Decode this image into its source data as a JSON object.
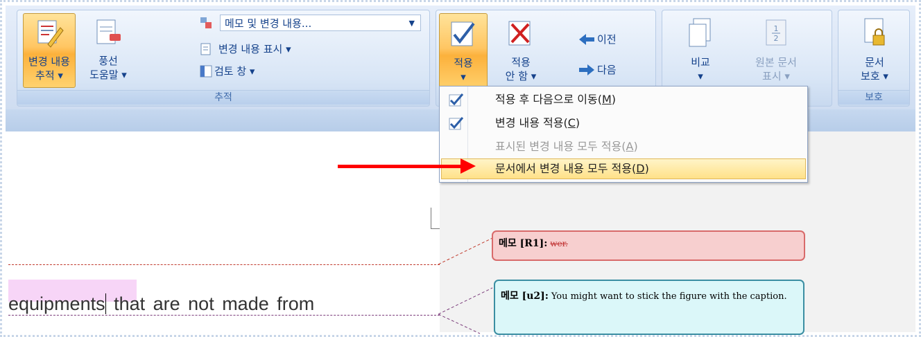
{
  "ribbon": {
    "track_group": {
      "track_changes": {
        "line1": "변경 내용",
        "line2": "추적 ▾"
      },
      "balloons": {
        "line1": "풍선",
        "line2": "도움말 ▾"
      },
      "markup_combo": "메모 및 변경 내용...",
      "show_markup": "변경 내용 표시 ▾",
      "review_pane": "검토 창 ▾",
      "label": "추적"
    },
    "changes_group": {
      "accept": {
        "line1": "적용",
        "line2": "▾"
      },
      "reject": {
        "line1": "적용",
        "line2": "안 함 ▾"
      },
      "previous": "이전",
      "next": "다음"
    },
    "compare_group": {
      "compare": {
        "line1": "비교",
        "line2": "▾"
      },
      "show_source": {
        "line1": "원본 문서",
        "line2": "표시 ▾"
      }
    },
    "protect_group": {
      "protect": {
        "line1": "문서",
        "line2": "보호 ▾"
      },
      "label": "보호"
    }
  },
  "accept_menu": {
    "items": [
      {
        "pre": "적용 후 다음으로 이동(",
        "key": "M",
        "post": ")"
      },
      {
        "pre": "변경 내용 적용(",
        "key": "C",
        "post": ")"
      },
      {
        "pre": "표시된 변경 내용 모두 적용(",
        "key": "A",
        "post": ")"
      },
      {
        "pre": "문서에서 변경 내용 모두 적용(",
        "key": "D",
        "post": ")"
      }
    ]
  },
  "comments": [
    {
      "head": "메모 [R1]:",
      "text": "wer."
    },
    {
      "head": "메모 [u2]:",
      "text": "You might want to stick the figure with the caption."
    }
  ],
  "document": {
    "highlighted_word": "equipments",
    "rest": " that are not made from"
  },
  "colors": {
    "ribbon_text": "#15428b",
    "active_button": "#fcb13c",
    "arrow": "#ff0000",
    "comment1_bg": "#f7cfcf",
    "comment2_bg": "#dbf7f9"
  }
}
